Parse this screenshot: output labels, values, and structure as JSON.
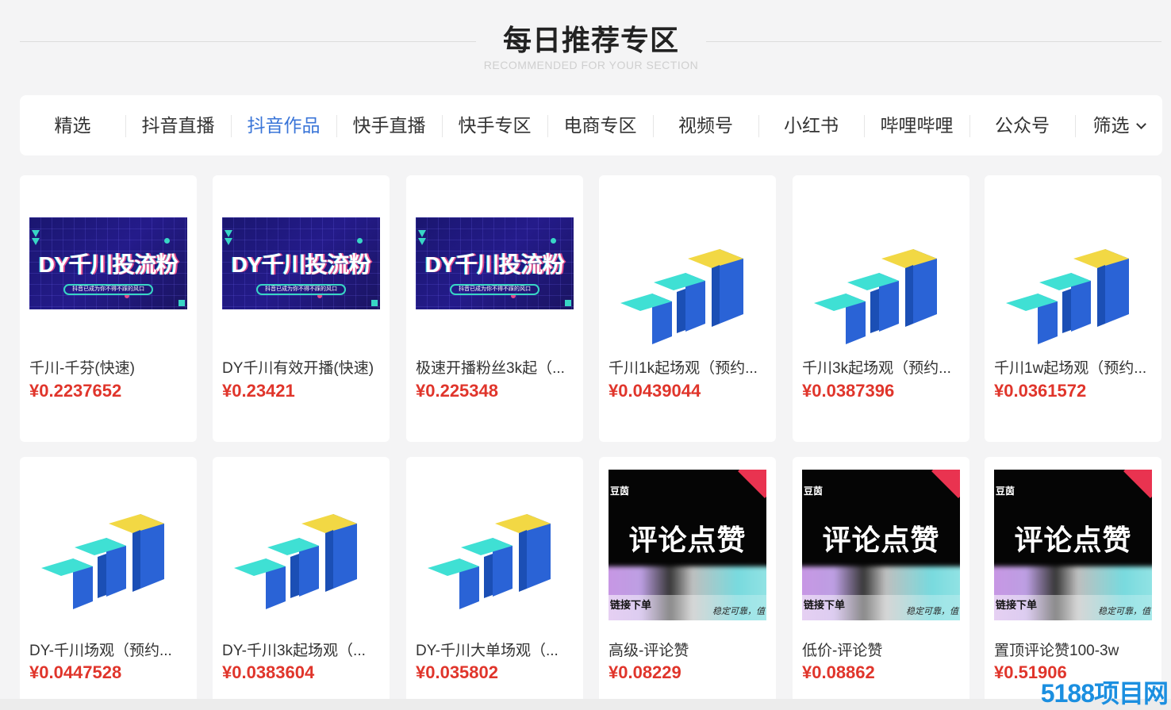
{
  "section": {
    "title": "每日推荐专区",
    "subtitle": "RECOMMENDED FOR YOUR SECTION"
  },
  "tabs": [
    {
      "label": "精选"
    },
    {
      "label": "抖音直播"
    },
    {
      "label": "抖音作品",
      "active": true
    },
    {
      "label": "快手直播"
    },
    {
      "label": "快手专区"
    },
    {
      "label": "电商专区"
    },
    {
      "label": "视频号"
    },
    {
      "label": "小红书"
    },
    {
      "label": "哔哩哔哩"
    },
    {
      "label": "公众号"
    }
  ],
  "filter_label": "筛选",
  "products": [
    {
      "name": "千川-千芬(快速)",
      "price": "¥0.2237652",
      "image": "dy-qianchuan-banner"
    },
    {
      "name": "DY千川有效开播(快速)",
      "price": "¥0.23421",
      "image": "dy-qianchuan-banner"
    },
    {
      "name": "极速开播粉丝3k起（...",
      "price": "¥0.225348",
      "image": "dy-qianchuan-banner"
    },
    {
      "name": "千川1k起场观（预约...",
      "price": "¥0.0439044",
      "image": "bar-steps-logo"
    },
    {
      "name": "千川3k起场观（预约...",
      "price": "¥0.0387396",
      "image": "bar-steps-logo"
    },
    {
      "name": "千川1w起场观（预约...",
      "price": "¥0.0361572",
      "image": "bar-steps-logo"
    },
    {
      "name": "DY-千川场观（预约...",
      "price": "¥0.0447528",
      "image": "bar-steps-logo"
    },
    {
      "name": "DY-千川3k起场观（...",
      "price": "¥0.0383604",
      "image": "bar-steps-logo"
    },
    {
      "name": "DY-千川大单场观（...",
      "price": "¥0.035802",
      "image": "bar-steps-logo"
    },
    {
      "name": "高级-评论赞",
      "price": "¥0.08229",
      "image": "comment-like-banner"
    },
    {
      "name": "低价-评论赞",
      "price": "¥0.08862",
      "image": "comment-like-banner"
    },
    {
      "name": "置顶评论赞100-3w",
      "price": "¥0.51906",
      "image": "comment-like-banner"
    }
  ],
  "banners": {
    "dy": {
      "headline": "DY千川投流粉",
      "tagline": "抖音已成为你不得不踩的风口"
    },
    "comment": {
      "brand": "豆茵",
      "headline": "评论点赞",
      "cta": "链接下单",
      "note": "稳定可靠，值"
    }
  },
  "watermark": "5188项目网",
  "colors": {
    "accent": "#3a75d8",
    "price": "#e0352b",
    "bar_blue": "#2a63d6",
    "bar_cyan": "#3fe0d4",
    "bar_yellow": "#f2d844"
  }
}
